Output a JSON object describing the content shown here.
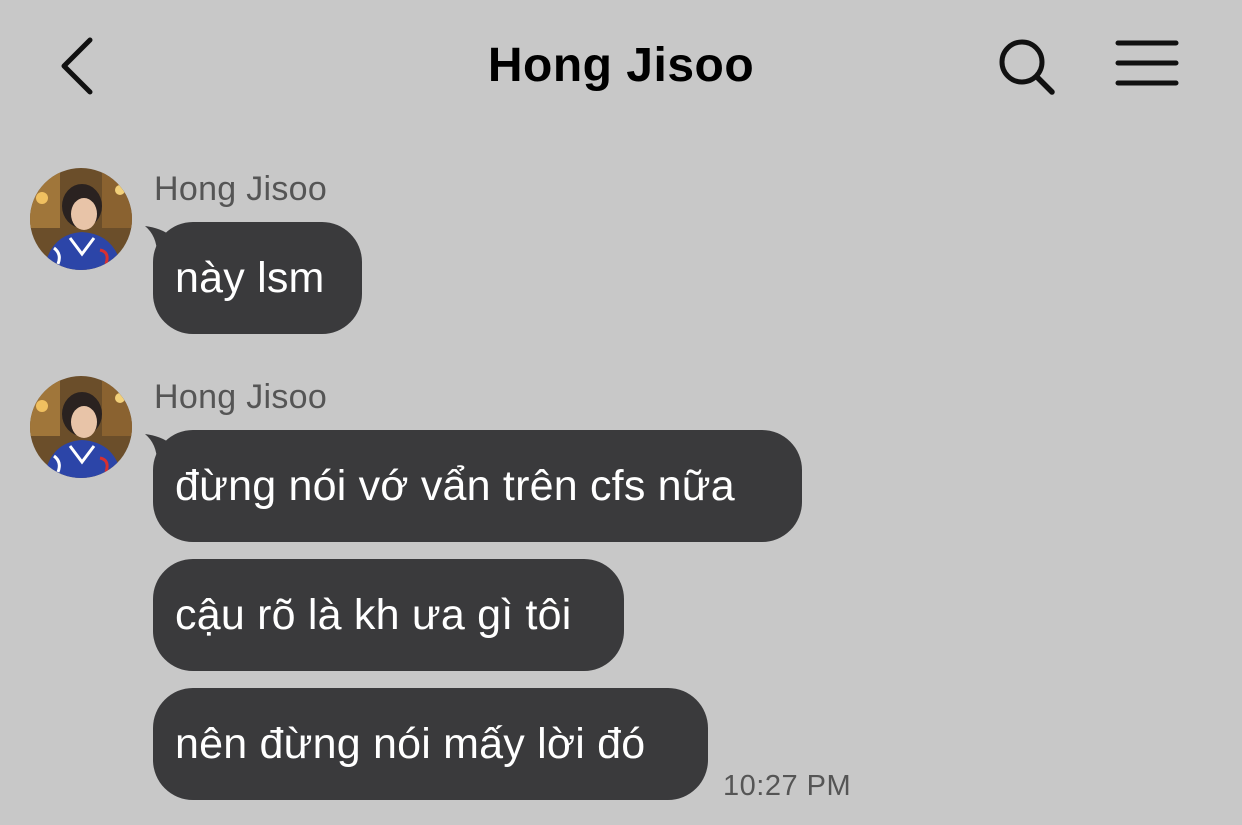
{
  "header": {
    "title": "Hong Jisoo",
    "back_icon": "chevron-left-icon",
    "search_icon": "search-icon",
    "menu_icon": "hamburger-menu-icon"
  },
  "colors": {
    "background": "#c8c8c8",
    "bubble": "#3a3a3c",
    "bubble_text": "#ffffff",
    "sender_text": "#555555"
  },
  "messages": [
    {
      "sender": "Hong Jisoo",
      "bubbles": [
        "này lsm"
      ]
    },
    {
      "sender": "Hong Jisoo",
      "bubbles": [
        "đừng nói vớ vẩn trên cfs nữa",
        "cậu rõ là kh ưa gì tôi",
        "nên đừng nói mấy lời đó"
      ],
      "time": "10:27 PM"
    }
  ]
}
